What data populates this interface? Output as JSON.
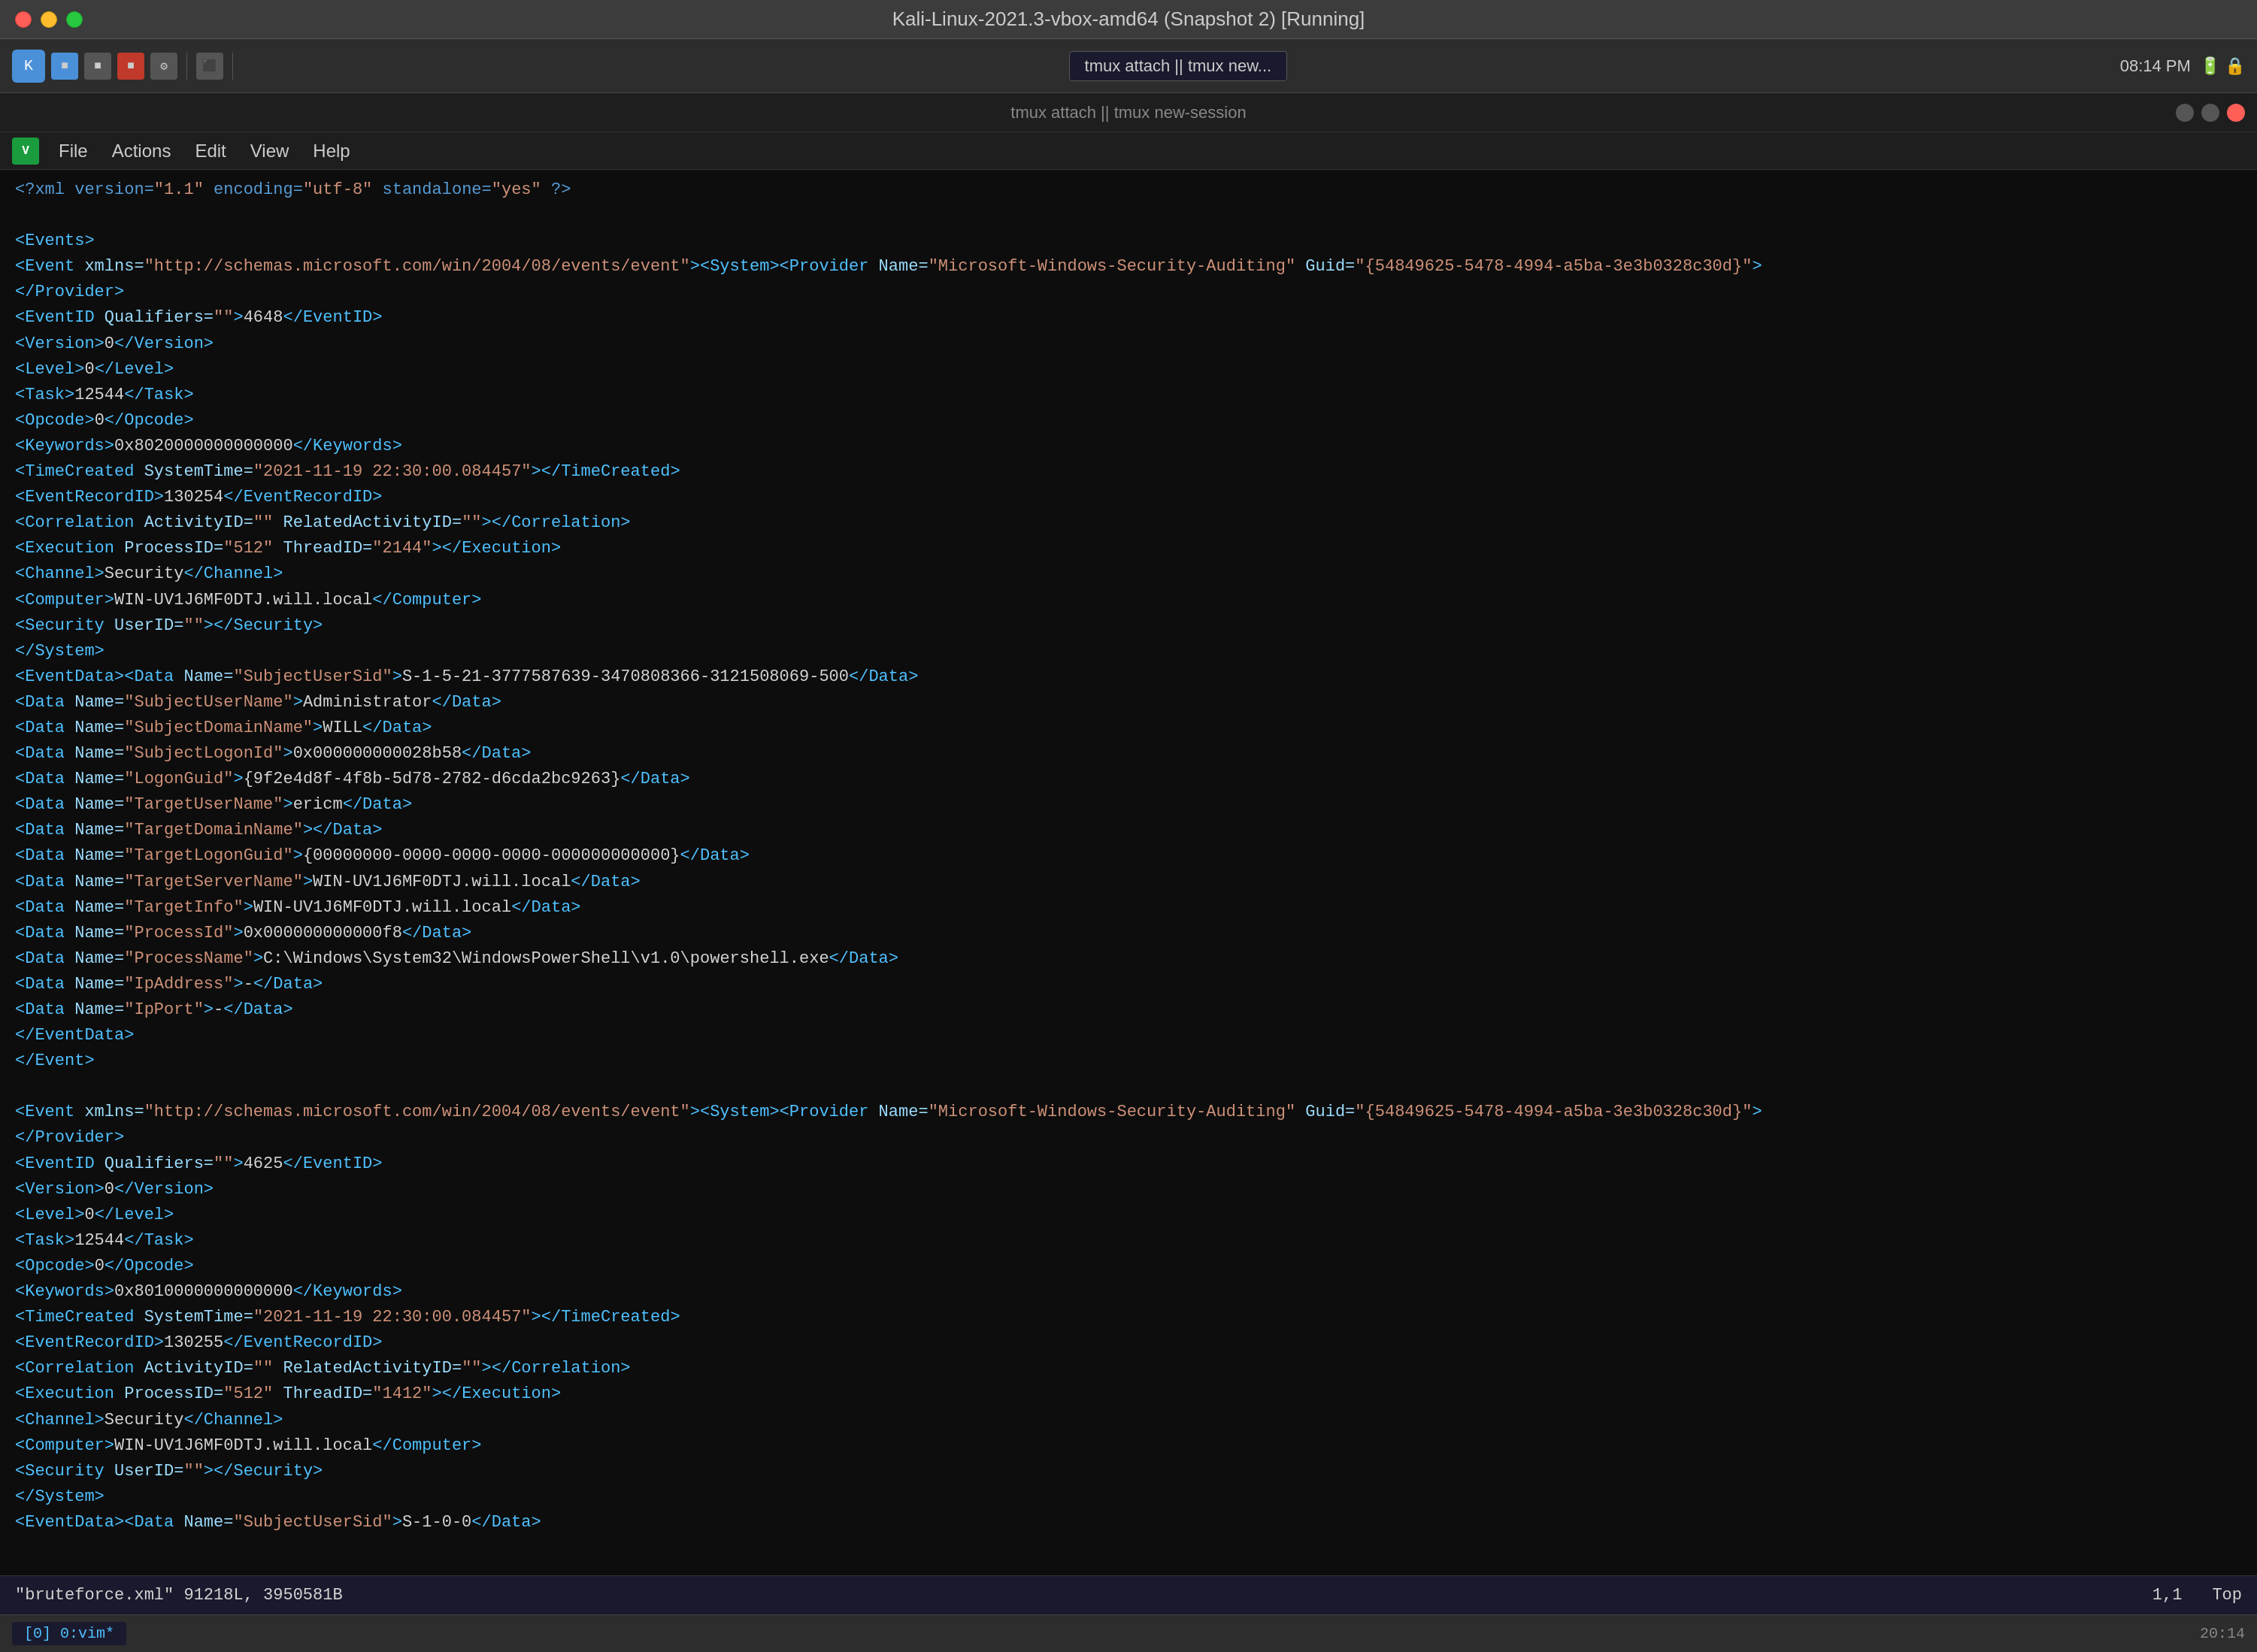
{
  "window": {
    "title": "Kali-Linux-2021.3-vbox-amd64 (Snapshot 2) [Running]",
    "traffic_lights": [
      "close",
      "minimize",
      "maximize"
    ]
  },
  "toolbar": {
    "tab_label": "tmux attach || tmux new...",
    "time": "08:14 PM"
  },
  "tab_bar": {
    "title": "tmux attach || tmux new-session",
    "close_label": "×"
  },
  "menu": {
    "items": [
      "File",
      "Actions",
      "Edit",
      "View",
      "Help"
    ]
  },
  "editor": {
    "lines": [
      "<?xml version=\"1.1\" encoding=\"utf-8\" standalone=\"yes\" ?>",
      "",
      "<Events>",
      "<Event xmlns=\"http://schemas.microsoft.com/win/2004/08/events/event\"><System><Provider Name=\"Microsoft-Windows-Security-Auditing\" Guid=\"{54849625-5478-4994-a5ba-3e3b0328c30d}\">",
      "</Provider>",
      "<EventID Qualifiers=\"\">4648</EventID>",
      "<Version>0</Version>",
      "<Level>0</Level>",
      "<Task>12544</Task>",
      "<Opcode>0</Opcode>",
      "<Keywords>0x8020000000000000</Keywords>",
      "<TimeCreated SystemTime=\"2021-11-19 22:30:00.084457\"></TimeCreated>",
      "<EventRecordID>130254</EventRecordID>",
      "<Correlation ActivityID=\"\" RelatedActivityID=\"\"></Correlation>",
      "<Execution ProcessID=\"512\" ThreadID=\"2144\"></Execution>",
      "<Channel>Security</Channel>",
      "<Computer>WIN-UV1J6MF0DTJ.will.local</Computer>",
      "<Security UserID=\"\"></Security>",
      "</System>",
      "<EventData><Data Name=\"SubjectUserSid\">S-1-5-21-3777587639-3470808366-3121508069-500</Data>",
      "<Data Name=\"SubjectUserName\">Administrator</Data>",
      "<Data Name=\"SubjectDomainName\">WILL</Data>",
      "<Data Name=\"SubjectLogonId\">0x000000000028b58</Data>",
      "<Data Name=\"LogonGuid\">{9f2e4d8f-4f8b-5d78-2782-d6cda2bc9263}</Data>",
      "<Data Name=\"TargetUserName\">ericm</Data>",
      "<Data Name=\"TargetDomainName\"></Data>",
      "<Data Name=\"TargetLogonGuid\">{00000000-0000-0000-0000-000000000000}</Data>",
      "<Data Name=\"TargetServerName\">WIN-UV1J6MF0DTJ.will.local</Data>",
      "<Data Name=\"TargetInfo\">WIN-UV1J6MF0DTJ.will.local</Data>",
      "<Data Name=\"ProcessId\">0x000000000000f8</Data>",
      "<Data Name=\"ProcessName\">C:\\Windows\\System32\\WindowsPowerShell\\v1.0\\powershell.exe</Data>",
      "<Data Name=\"IpAddress\">-</Data>",
      "<Data Name=\"IpPort\">-</Data>",
      "</EventData>",
      "</Event>",
      "",
      "<Event xmlns=\"http://schemas.microsoft.com/win/2004/08/events/event\"><System><Provider Name=\"Microsoft-Windows-Security-Auditing\" Guid=\"{54849625-5478-4994-a5ba-3e3b0328c30d}\">",
      "</Provider>",
      "<EventID Qualifiers=\"\">4625</EventID>",
      "<Version>0</Version>",
      "<Level>0</Level>",
      "<Task>12544</Task>",
      "<Opcode>0</Opcode>",
      "<Keywords>0x8010000000000000</Keywords>",
      "<TimeCreated SystemTime=\"2021-11-19 22:30:00.084457\"></TimeCreated>",
      "<EventRecordID>130255</EventRecordID>",
      "<Correlation ActivityID=\"\" RelatedActivityID=\"\"></Correlation>",
      "<Execution ProcessID=\"512\" ThreadID=\"1412\"></Execution>",
      "<Channel>Security</Channel>",
      "<Computer>WIN-UV1J6MF0DTJ.will.local</Computer>",
      "<Security UserID=\"\"></Security>",
      "</System>",
      "<EventData><Data Name=\"SubjectUserSid\">S-1-0-0</Data>"
    ]
  },
  "status_bar": {
    "file_info": "\"bruteforce.xml\" 91218L, 3950581B",
    "position": "1,1",
    "scroll": "Top",
    "time": "20:14"
  },
  "bottom_bar": {
    "tab_label": "[0] 0:vim*",
    "left_label": "20:14"
  }
}
